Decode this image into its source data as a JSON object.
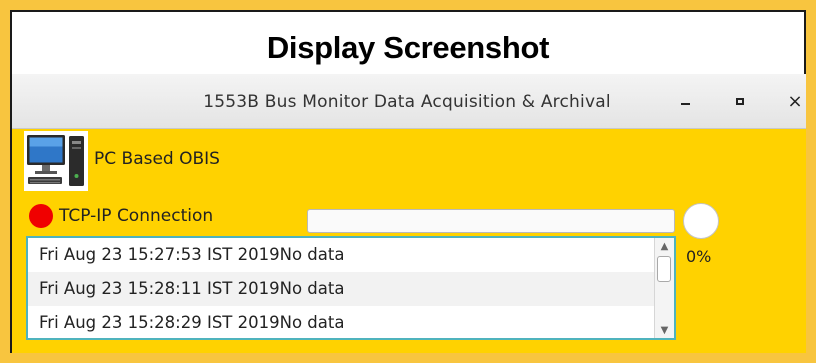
{
  "caption": "Display Screenshot",
  "window": {
    "title": "1553B Bus Monitor Data Acquisition & Archival",
    "controls": {
      "minimize_icon": "minimize-icon",
      "maximize_icon": "maximize-icon",
      "close_icon": "close-icon",
      "close_glyph": "×"
    }
  },
  "app": {
    "icon": "desktop-computer-icon",
    "label": "PC Based OBIS"
  },
  "connection": {
    "label": "TCP-IP Connection",
    "status_color": "#f00000"
  },
  "progress": {
    "value": 0,
    "label": "0%"
  },
  "log": {
    "entries": [
      "Fri Aug 23 15:27:53 IST 2019No data",
      "Fri Aug 23 15:28:11 IST 2019No data",
      "Fri Aug 23 15:28:29 IST 2019No data"
    ]
  },
  "colors": {
    "frame": "#f8c53f",
    "content_bg": "#ffd200",
    "log_border": "#4fb3bd"
  }
}
